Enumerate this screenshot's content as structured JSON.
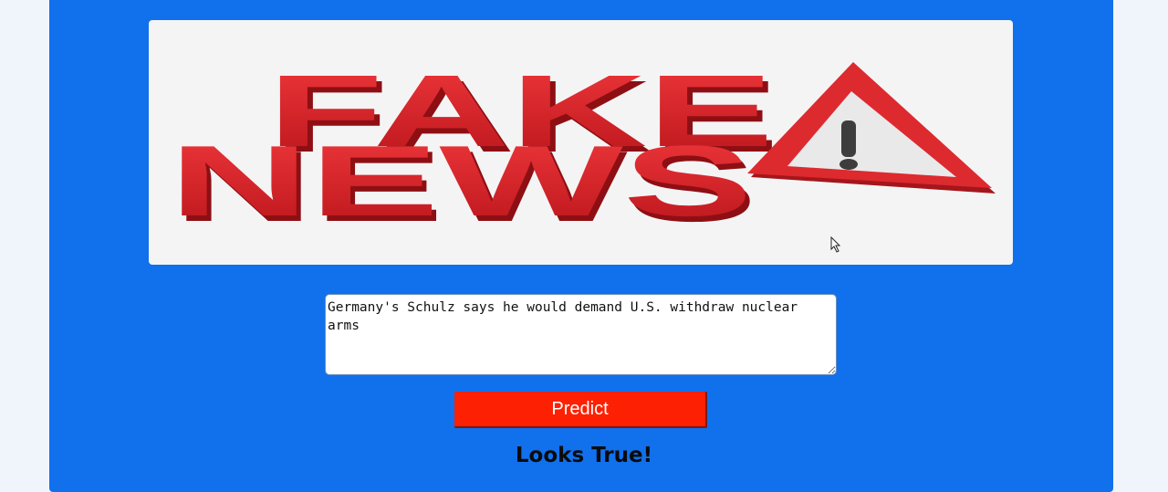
{
  "banner": {
    "line1": "FAKE",
    "line2": "NEWS",
    "warning_glyph": "!"
  },
  "form": {
    "news_text": "Germany's Schulz says he would demand U.S. withdraw nuclear arms",
    "predict_label": "Predict"
  },
  "result": {
    "text": "Looks True!"
  },
  "colors": {
    "panel": "#1170ec",
    "page": "#f0f5fc",
    "button": "#fe2002",
    "banner_red": "#d9262c"
  },
  "icons": {
    "warning": "warning-triangle-icon",
    "cursor": "mouse-pointer-icon"
  }
}
